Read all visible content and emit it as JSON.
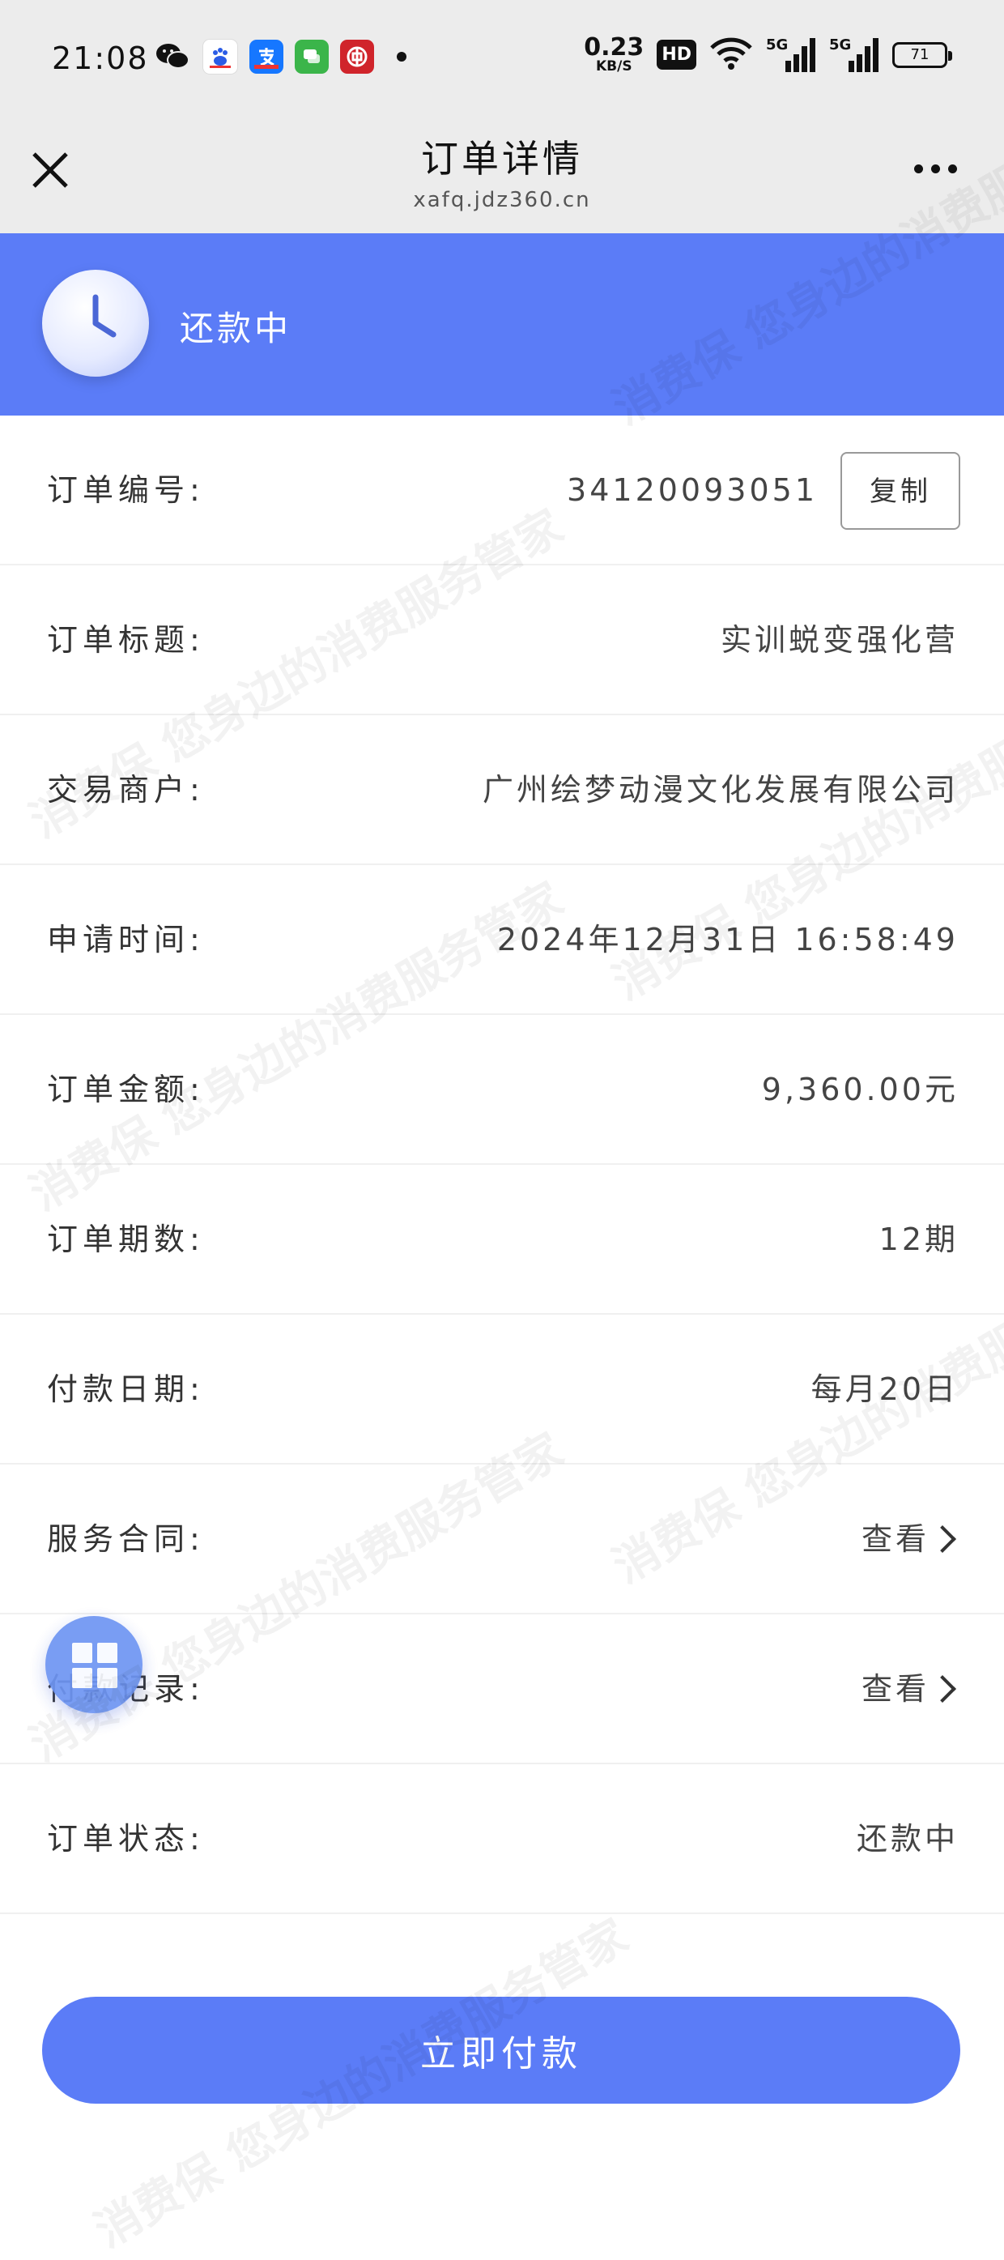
{
  "status_bar": {
    "time": "21:08",
    "net_speed": "0.23",
    "net_unit": "KB/S",
    "hd": "HD",
    "signal1": "5G",
    "signal2": "5G",
    "battery": "71"
  },
  "nav": {
    "title": "订单详情",
    "url": "xafq.jdz360.cn"
  },
  "banner": {
    "status": "还款中"
  },
  "rows": [
    {
      "label": "订单编号:",
      "value": "34120093051"
    },
    {
      "label": "订单标题:",
      "value": "实训蜕变强化营"
    },
    {
      "label": "交易商户:",
      "value": "广州绘梦动漫文化发展有限公司"
    },
    {
      "label": "申请时间:",
      "value": "2024年12月31日 16:58:49"
    },
    {
      "label": "订单金额:",
      "value": "9,360.00元"
    },
    {
      "label": "订单期数:",
      "value": "12期"
    },
    {
      "label": "付款日期:",
      "value": "每月20日"
    },
    {
      "label": "服务合同:",
      "value": "查看"
    },
    {
      "label": "付款记录:",
      "value": "查看"
    },
    {
      "label": "订单状态:",
      "value": "还款中"
    }
  ],
  "copy_label": "复制",
  "pay_label": "立即付款",
  "watermark": "消费保 您身边的消费服务管家",
  "colors": {
    "accent": "#5b7cf7",
    "float_button": "#6e95f3"
  },
  "icons": {
    "close": "close-icon",
    "more": "more-icon",
    "clock": "clock-icon",
    "chevron": "chevron-right-icon",
    "float": "grid-icon"
  }
}
